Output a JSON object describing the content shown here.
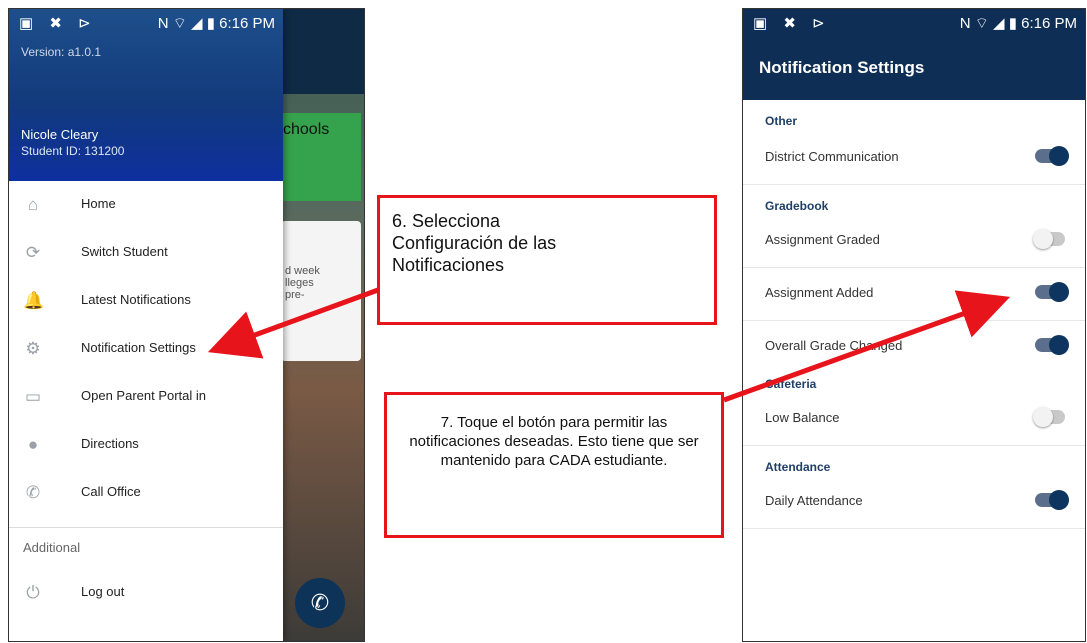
{
  "left_phone": {
    "statusbar": {
      "time": "6:16 PM",
      "left_icons": "▣ ✖ ⊳",
      "right_icons": "N ⌔ ◢ ▮ "
    },
    "drawer": {
      "version": "Version: a1.0.1",
      "name": "Nicole Cleary",
      "student_id": "Student ID: 131200",
      "items": [
        {
          "label": "Home",
          "icon": "home-icon",
          "glyph": "⌂"
        },
        {
          "label": "Switch Student",
          "icon": "switch-icon",
          "glyph": "⟳"
        },
        {
          "label": "Latest Notifications",
          "icon": "bell-icon",
          "glyph": "🔔"
        },
        {
          "label": "Notification Settings",
          "icon": "gear-icon",
          "glyph": "⚙"
        },
        {
          "label": "Open Parent Portal in",
          "icon": "browser-icon",
          "glyph": "▭"
        },
        {
          "label": "Directions",
          "icon": "map-pin-icon",
          "glyph": "●"
        },
        {
          "label": "Call Office",
          "icon": "phone-icon",
          "glyph": "✆"
        }
      ],
      "additional_label": "Additional",
      "logout": {
        "label": "Log out",
        "icon": "power-icon",
        "glyph": "⏻"
      }
    },
    "background": {
      "green_card_text": "chools",
      "white_card_text": "d week\nlleges\npre-"
    }
  },
  "right_phone": {
    "statusbar": {
      "time": "6:16 PM",
      "left_icons": "▣ ✖ ⊳",
      "right_icons": "N ⌔ ◢ ▮ "
    },
    "title": "Notification Settings",
    "sections": [
      {
        "name": "Other",
        "rows": [
          {
            "label": "District Communication",
            "on": true
          }
        ]
      },
      {
        "name": "Gradebook",
        "rows": [
          {
            "label": "Assignment Graded",
            "on": false
          },
          {
            "label": "Assignment Added",
            "on": true
          },
          {
            "label": "Overall Grade Changed",
            "on": true
          }
        ]
      },
      {
        "name": "Cafeteria",
        "rows": [
          {
            "label": "Low Balance",
            "on": false
          }
        ]
      },
      {
        "name": "Attendance",
        "rows": [
          {
            "label": "Daily Attendance",
            "on": true
          }
        ]
      }
    ]
  },
  "callouts": {
    "step6": "6. Selecciona\nConfiguración de las\nNotificaciones",
    "step7": "7. Toque el botón para permitir las notificaciones deseadas. Esto tiene que ser mantenido para CADA estudiante."
  },
  "colors": {
    "arrow": "#e8141c",
    "header_blue": "#0f2e55",
    "toggle_on": "#0e3560"
  }
}
